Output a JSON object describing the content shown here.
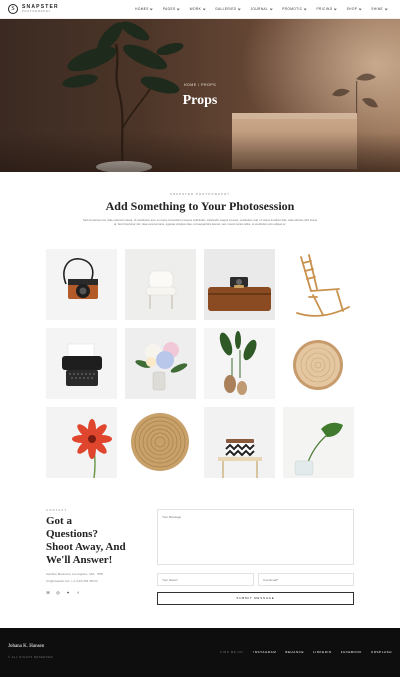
{
  "brand": {
    "name": "SNAPSTER",
    "sub": "PHOTOGRAPHY",
    "mark": "S"
  },
  "nav": [
    {
      "label": "HOMES"
    },
    {
      "label": "PAGES"
    },
    {
      "label": "WORK"
    },
    {
      "label": "GALLERIES"
    },
    {
      "label": "JOURNAL"
    },
    {
      "label": "PROMOTIC"
    },
    {
      "label": "PRICING"
    },
    {
      "label": "SHOP"
    },
    {
      "label": "SHINE"
    }
  ],
  "hero": {
    "breadcrumb": "HOME / PROPS",
    "title": "Props"
  },
  "intro": {
    "kicker": "SNAPSTER PHOTOGRAPHY",
    "title": "Add Something to Your Photosession",
    "text": "Sed id pulvinar nisl, vitae euismod massa. Ut vestibulum arcu eu turpis consectetur posuere sollicitudin, sollicitudin magna sit amet, vestibulum erat. Ut varius tincidunt felis, vitae ultricies nibh luctus at. Sed id pulvinar nisl, vitae euismod ante, egestas volutpat vitae, consequat felis laoreet, sem mauris luctus tellus, ut vestibulum arcu aliquet et."
  },
  "grid_items": [
    {
      "name": "camera-strap"
    },
    {
      "name": "white-chair"
    },
    {
      "name": "camera-suitcase"
    },
    {
      "name": "rocking-chair"
    },
    {
      "name": "typewriter"
    },
    {
      "name": "flower-vase"
    },
    {
      "name": "plant-vases"
    },
    {
      "name": "wood-slice"
    },
    {
      "name": "gerbera-flower"
    },
    {
      "name": "woven-placemat"
    },
    {
      "name": "stool-basket"
    },
    {
      "name": "monstera-leaf"
    }
  ],
  "contact": {
    "kicker": "CONTACT",
    "title": "Got a Questions? Shoot Away, And We'll Answer!",
    "address": "Hamilton Boulevard, Los Angeles, USA · 7855",
    "phone_email": "info@snapster.com  |  +1 (123) 456 789 00",
    "socials": [
      "mail-icon",
      "instagram-icon",
      "twitter-icon",
      "facebook-icon"
    ]
  },
  "form": {
    "message_placeholder": "Your Message",
    "name_placeholder": "Your Name*",
    "email_placeholder": "Your Email*",
    "submit_label": "SUBMIT MESSAGE"
  },
  "footer": {
    "name": "Johana K. Hansen",
    "copyright": "© ALL RIGHTS RESERVED",
    "find_label": "FIND ME ON:",
    "links": [
      "INSTAGRAM",
      "BEHANCE",
      "LINKEDIN",
      "FACEBOOK",
      "UNSPLASH"
    ]
  }
}
